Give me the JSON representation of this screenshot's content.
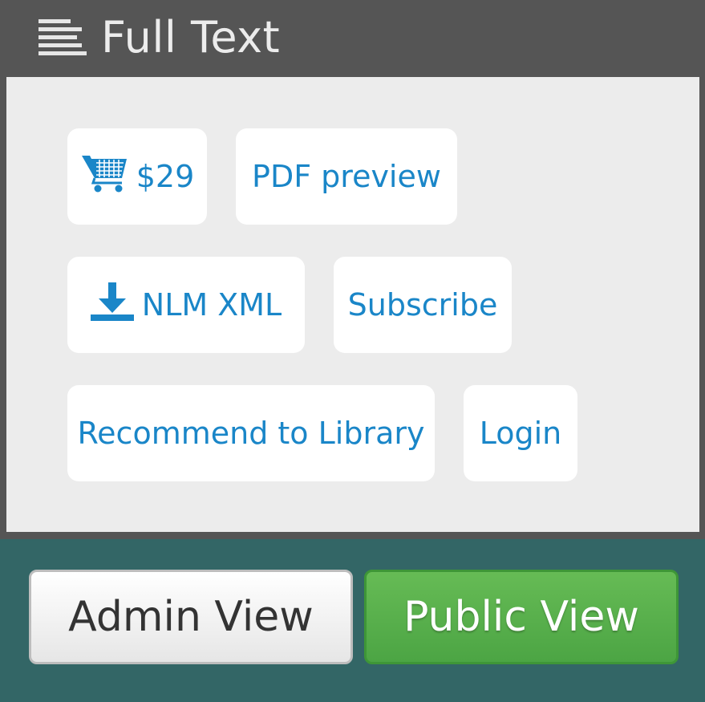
{
  "header": {
    "title": "Full Text",
    "icon": "menu-lines-icon"
  },
  "actions": {
    "price": "$29",
    "pdf_preview": "PDF preview",
    "nlm_xml": "NLM XML",
    "subscribe": "Subscribe",
    "recommend": "Recommend to Library",
    "login": "Login"
  },
  "view_toggle": {
    "admin": "Admin View",
    "public": "Public View"
  },
  "colors": {
    "accent": "#1a86c8",
    "public_green": "#55aa4a",
    "teal_bg": "#336666",
    "header_bg": "#555555",
    "panel_bg": "#ececec"
  }
}
